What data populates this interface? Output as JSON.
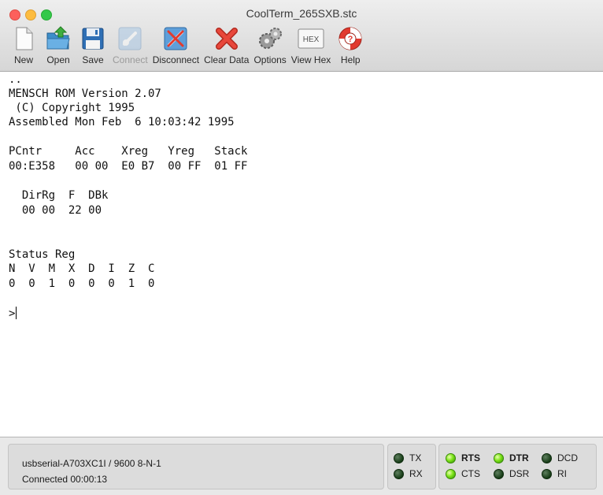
{
  "window": {
    "title": "CoolTerm_265SXB.stc"
  },
  "toolbar": {
    "new": "New",
    "open": "Open",
    "save": "Save",
    "connect": "Connect",
    "disconnect": "Disconnect",
    "clear_data": "Clear Data",
    "options": "Options",
    "view_hex": "View Hex",
    "hex_badge": "HEX",
    "help": "Help"
  },
  "terminal": {
    "lines": [
      "..",
      "MENSCH ROM Version 2.07",
      " (C) Copyright 1995",
      "Assembled Mon Feb  6 10:03:42 1995",
      "",
      "PCntr     Acc    Xreg   Yreg   Stack",
      "00:E358   00 00  E0 B7  00 FF  01 FF",
      "",
      "  DirRg  F  DBk",
      "  00 00  22 00",
      "",
      "",
      "Status Reg",
      "N  V  M  X  D  I  Z  C",
      "0  0  1  0  0  0  1  0",
      "",
      ">"
    ]
  },
  "status": {
    "port": "usbserial-A703XC1I / 9600 8-N-1",
    "connection": "Connected 00:00:13",
    "leds": {
      "tx": "TX",
      "rx": "RX",
      "rts": "RTS",
      "cts": "CTS",
      "dtr": "DTR",
      "dsr": "DSR",
      "dcd": "DCD",
      "ri": "RI"
    }
  }
}
